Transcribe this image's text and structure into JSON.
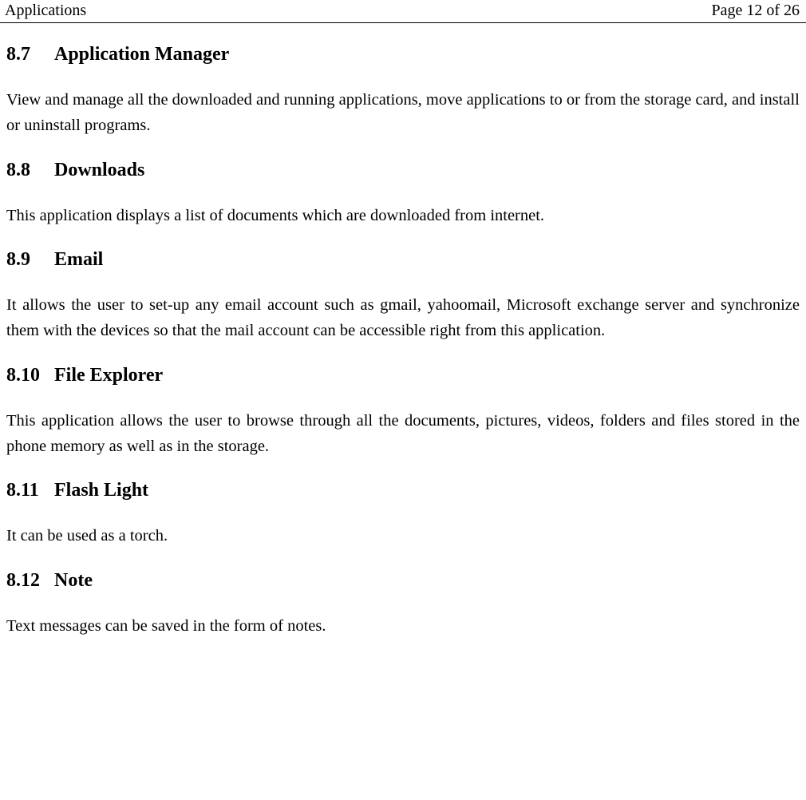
{
  "header": {
    "title": "Applications",
    "page_info": "Page 12 of 26"
  },
  "sections": {
    "s87": {
      "number": "8.7",
      "title": "Application Manager",
      "body": "View and manage all the downloaded and running applications, move applications to or from the storage card, and install or uninstall programs."
    },
    "s88": {
      "number": "8.8",
      "title": "Downloads",
      "body": "This application displays a list of documents which are downloaded from internet."
    },
    "s89": {
      "number": "8.9",
      "title": "Email",
      "body": "It allows the user to set-up any email account such as gmail, yahoomail, Microsoft exchange server and synchronize them with the devices  so that the mail account can be accessible right from this application."
    },
    "s810": {
      "number": "8.10",
      "title": "File Explorer",
      "body": "This application allows the user to browse through all the documents, pictures, videos, folders and files stored in the phone memory as well as in the storage."
    },
    "s811": {
      "number": "8.11",
      "title": "Flash Light",
      "body": "It can be used as a torch."
    },
    "s812": {
      "number": "8.12",
      "title": "Note",
      "body": "Text messages can be saved in the form of notes."
    }
  }
}
